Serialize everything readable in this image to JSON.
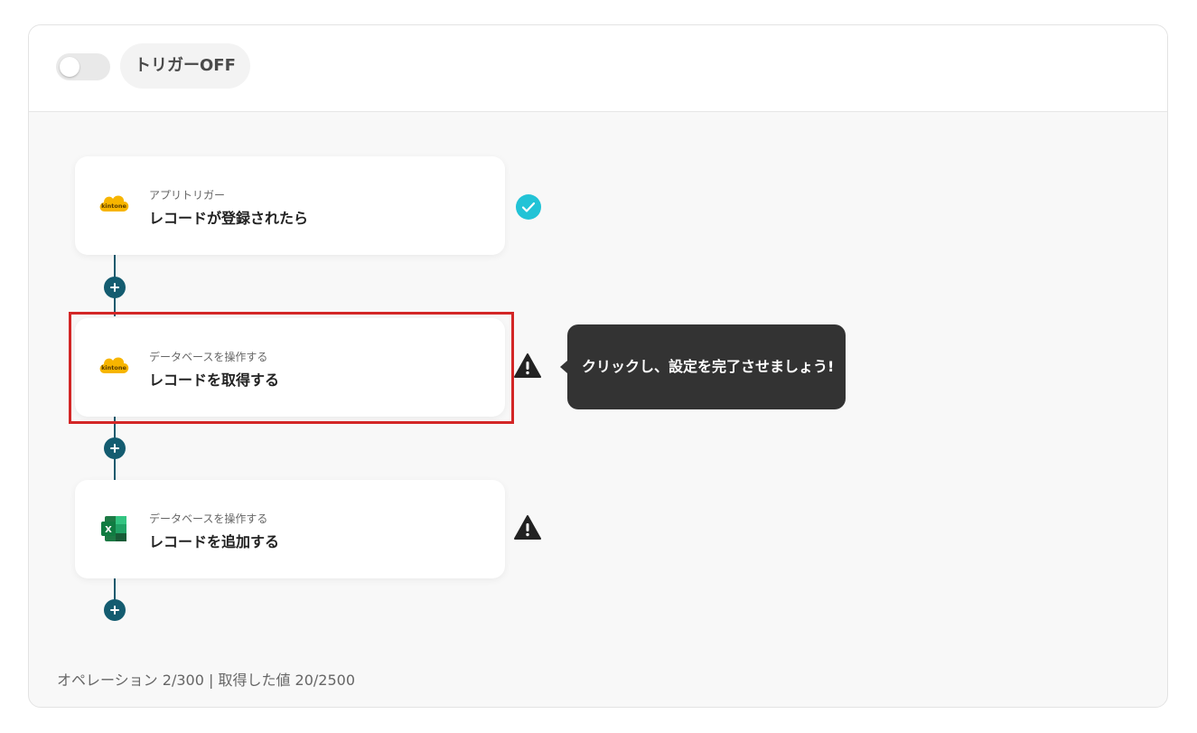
{
  "header": {
    "toggle_state": "off",
    "trigger_label": "トリガーOFF"
  },
  "flow": {
    "steps": [
      {
        "subtitle": "アプリトリガー",
        "title": "レコードが登録されたら",
        "app_icon": "kintone-icon",
        "app_label": "kintone",
        "status": "complete"
      },
      {
        "subtitle": "データベースを操作する",
        "title": "レコードを取得する",
        "app_icon": "kintone-icon",
        "app_label": "kintone",
        "status": "warning",
        "highlighted": true
      },
      {
        "subtitle": "データベースを操作する",
        "title": "レコードを追加する",
        "app_icon": "excel-icon",
        "app_label": "X",
        "status": "warning"
      }
    ]
  },
  "tooltip": {
    "text": "クリックし、設定を完了させましょう!"
  },
  "footer": {
    "usage": "オペレーション 2/300 | 取得した値 20/2500"
  },
  "colors": {
    "accent": "#145c70",
    "complete": "#22c3d6",
    "highlight": "#d32626",
    "kintone": "#f7b500",
    "excel": "#1d7a45"
  }
}
